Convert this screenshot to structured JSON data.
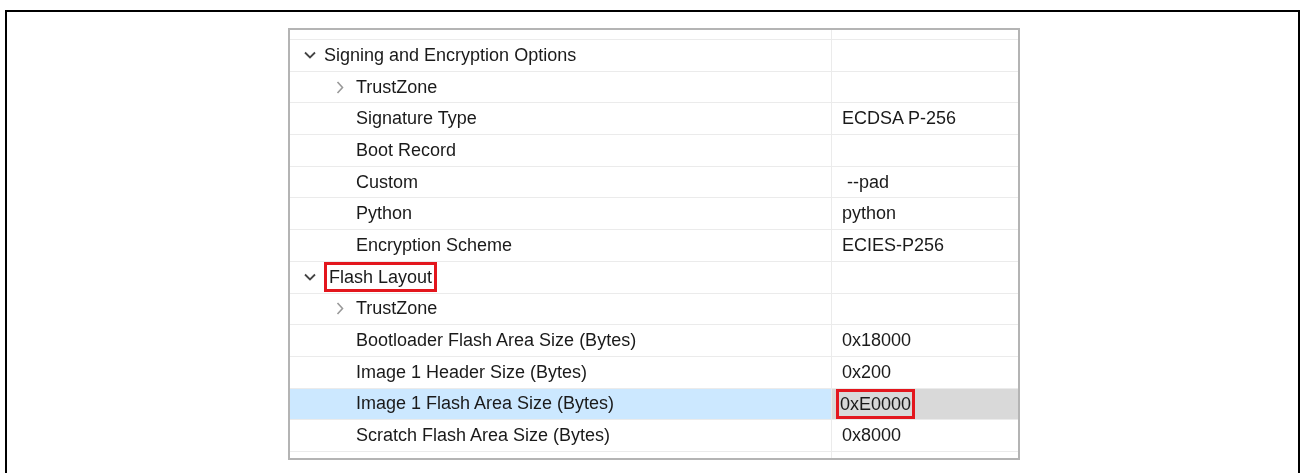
{
  "tree": [
    {
      "kind": "group",
      "label": "Signing and Encryption Options",
      "expanded": true,
      "selected": false,
      "label_boxed": false,
      "children": [
        {
          "kind": "group",
          "label": "TrustZone",
          "expanded": false,
          "selected": false,
          "label_boxed": false
        },
        {
          "kind": "setting",
          "label": "Signature Type",
          "value": "ECDSA P-256",
          "selected": false,
          "value_boxed": false
        },
        {
          "kind": "setting",
          "label": "Boot Record",
          "selected": false
        },
        {
          "kind": "setting",
          "label": "Custom",
          "value": " --pad",
          "selected": false,
          "value_boxed": false
        },
        {
          "kind": "setting",
          "label": "Python",
          "value": "python",
          "selected": false,
          "value_boxed": false
        },
        {
          "kind": "setting",
          "label": "Encryption Scheme",
          "value": "ECIES-P256",
          "selected": false,
          "value_boxed": false
        }
      ]
    },
    {
      "kind": "group",
      "label": "Flash Layout",
      "expanded": true,
      "selected": false,
      "label_boxed": true,
      "children": [
        {
          "kind": "group",
          "label": "TrustZone",
          "expanded": false,
          "selected": false,
          "label_boxed": false
        },
        {
          "kind": "setting",
          "label": "Bootloader Flash Area Size (Bytes)",
          "value": "0x18000",
          "selected": false,
          "value_boxed": false
        },
        {
          "kind": "setting",
          "label": "Image 1 Header Size (Bytes)",
          "value": "0x200",
          "selected": false,
          "value_boxed": false
        },
        {
          "kind": "setting",
          "label": "Image 1 Flash Area Size (Bytes)",
          "value": "0xE0000",
          "selected": true,
          "value_boxed": true
        },
        {
          "kind": "setting",
          "label": "Scratch Flash Area Size (Bytes)",
          "value": "0x8000",
          "selected": false,
          "value_boxed": false
        }
      ]
    }
  ]
}
